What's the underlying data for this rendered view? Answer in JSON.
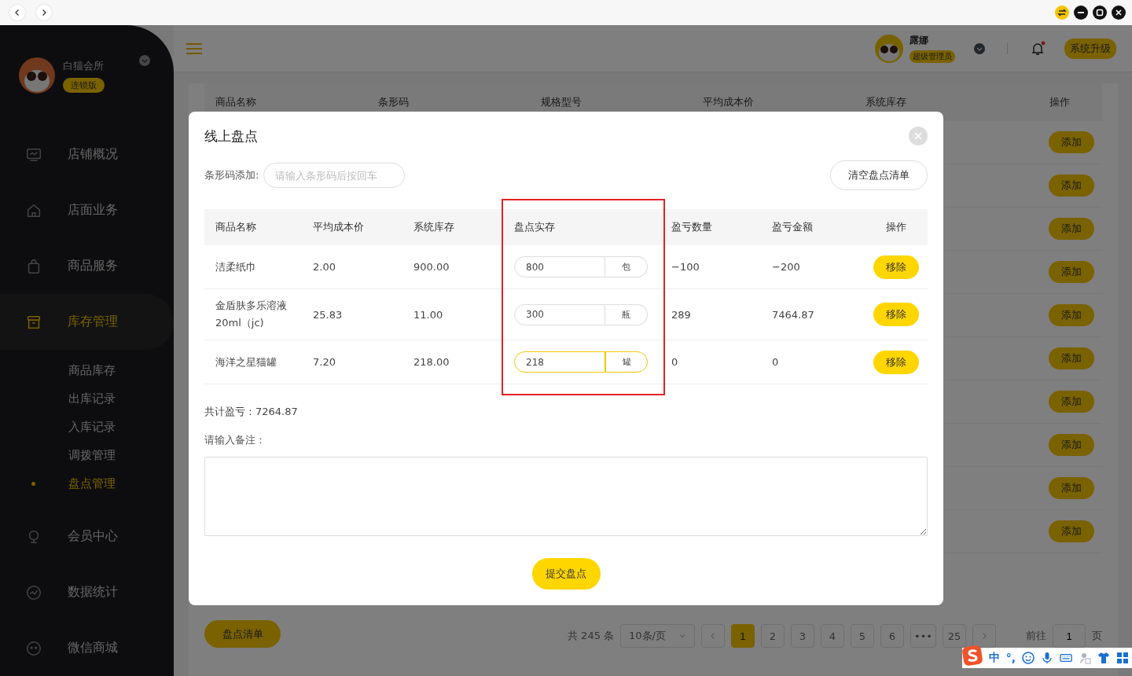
{
  "sidebar": {
    "store_name": "白猫会所",
    "edition": "连锁版",
    "items": [
      {
        "label": "店铺概况",
        "selected": false
      },
      {
        "label": "店面业务",
        "selected": false
      },
      {
        "label": "商品服务",
        "selected": false
      },
      {
        "label": "库存管理",
        "selected": true,
        "children": [
          {
            "label": "商品库存",
            "selected": false
          },
          {
            "label": "出库记录",
            "selected": false
          },
          {
            "label": "入库记录",
            "selected": false
          },
          {
            "label": "调拨管理",
            "selected": false
          },
          {
            "label": "盘点管理",
            "selected": true
          }
        ]
      },
      {
        "label": "会员中心",
        "selected": false
      },
      {
        "label": "数据统计",
        "selected": false
      },
      {
        "label": "微信商城",
        "selected": false
      }
    ]
  },
  "header": {
    "user_name": "露娜",
    "role": "超级管理员",
    "notification_unread": true,
    "upgrade_button": "系统升级"
  },
  "background_table": {
    "columns": [
      "商品名称",
      "条形码",
      "规格型号",
      "平均成本价",
      "系统库存",
      "操作"
    ],
    "rows": [
      {
        "action": "添加"
      },
      {
        "action": "添加"
      },
      {
        "action": "添加"
      },
      {
        "action": "添加"
      },
      {
        "action": "添加"
      },
      {
        "action": "添加"
      },
      {
        "action": "添加"
      },
      {
        "action": "添加"
      },
      {
        "action": "添加"
      },
      {
        "action": "添加"
      }
    ]
  },
  "list_button": "盘点清单",
  "pagination": {
    "total": "共 245 条",
    "page_size": "10条/页",
    "pages": [
      {
        "label": "1",
        "selected": true
      },
      {
        "label": "2",
        "selected": false
      },
      {
        "label": "3",
        "selected": false
      },
      {
        "label": "4",
        "selected": false
      },
      {
        "label": "5",
        "selected": false
      },
      {
        "label": "6",
        "selected": false
      },
      {
        "label": "•••",
        "selected": false
      },
      {
        "label": "25",
        "selected": false
      }
    ],
    "goto_label": "前往",
    "goto_value": "1",
    "goto_suffix": "页"
  },
  "dialog": {
    "title": "线上盘点",
    "barcode_label": "条形码添加:",
    "barcode_placeholder": "请输入条形码后按回车",
    "clear_button": "清空盘点清单",
    "columns": [
      {
        "label": "商品名称",
        "highlighted": false
      },
      {
        "label": "平均成本价",
        "highlighted": false
      },
      {
        "label": "系统库存",
        "highlighted": false
      },
      {
        "label": "盘点实存",
        "highlighted": true
      },
      {
        "label": "盈亏数量",
        "highlighted": false
      },
      {
        "label": "盈亏金额",
        "highlighted": false
      },
      {
        "label": "操作",
        "highlighted": false
      }
    ],
    "rows": [
      {
        "name": "洁柔纸巾",
        "avg_cost": "2.00",
        "stock": "900.00",
        "counted": "800",
        "unit": "包",
        "focused": false,
        "diff_qty": "−100",
        "diff_amount": "−200",
        "action": "移除"
      },
      {
        "name": "金盾肤多乐溶液20ml（jc)",
        "avg_cost": "25.83",
        "stock": "11.00",
        "counted": "300",
        "unit": "瓶",
        "focused": false,
        "diff_qty": "289",
        "diff_amount": "7464.87",
        "action": "移除"
      },
      {
        "name": "海洋之星猫罐",
        "avg_cost": "7.20",
        "stock": "218.00",
        "counted": "218",
        "unit": "罐",
        "focused": true,
        "diff_qty": "0",
        "diff_amount": "0",
        "action": "移除"
      }
    ],
    "total": "共计盈亏：7264.87",
    "remark_label": "请输入备注：",
    "submit_button": "提交盘点"
  },
  "ime_toolbar": {
    "mode": "中",
    "punctuation": "°,"
  }
}
